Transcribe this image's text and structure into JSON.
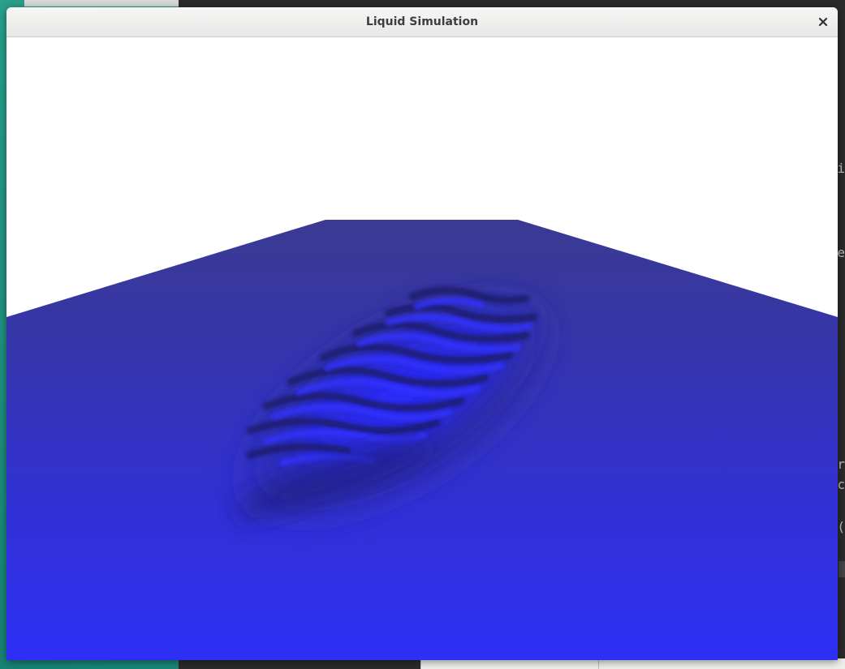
{
  "window": {
    "title": "Liquid Simulation",
    "close_icon": "close-icon"
  },
  "scene": {
    "sky_color": "#ffffff",
    "liquid_color_far": "#3a3a9e",
    "liquid_color_near": "#2e2ff5",
    "wave_highlight_color": "#2a2aff",
    "wave_shadow_color": "#1e1e7a"
  },
  "background": {
    "desktop_color": "#1a8f7e",
    "terminal_color": "#2b2b2b",
    "terminal_glyphs": [
      "i",
      "e",
      "r",
      "c",
      "("
    ]
  }
}
